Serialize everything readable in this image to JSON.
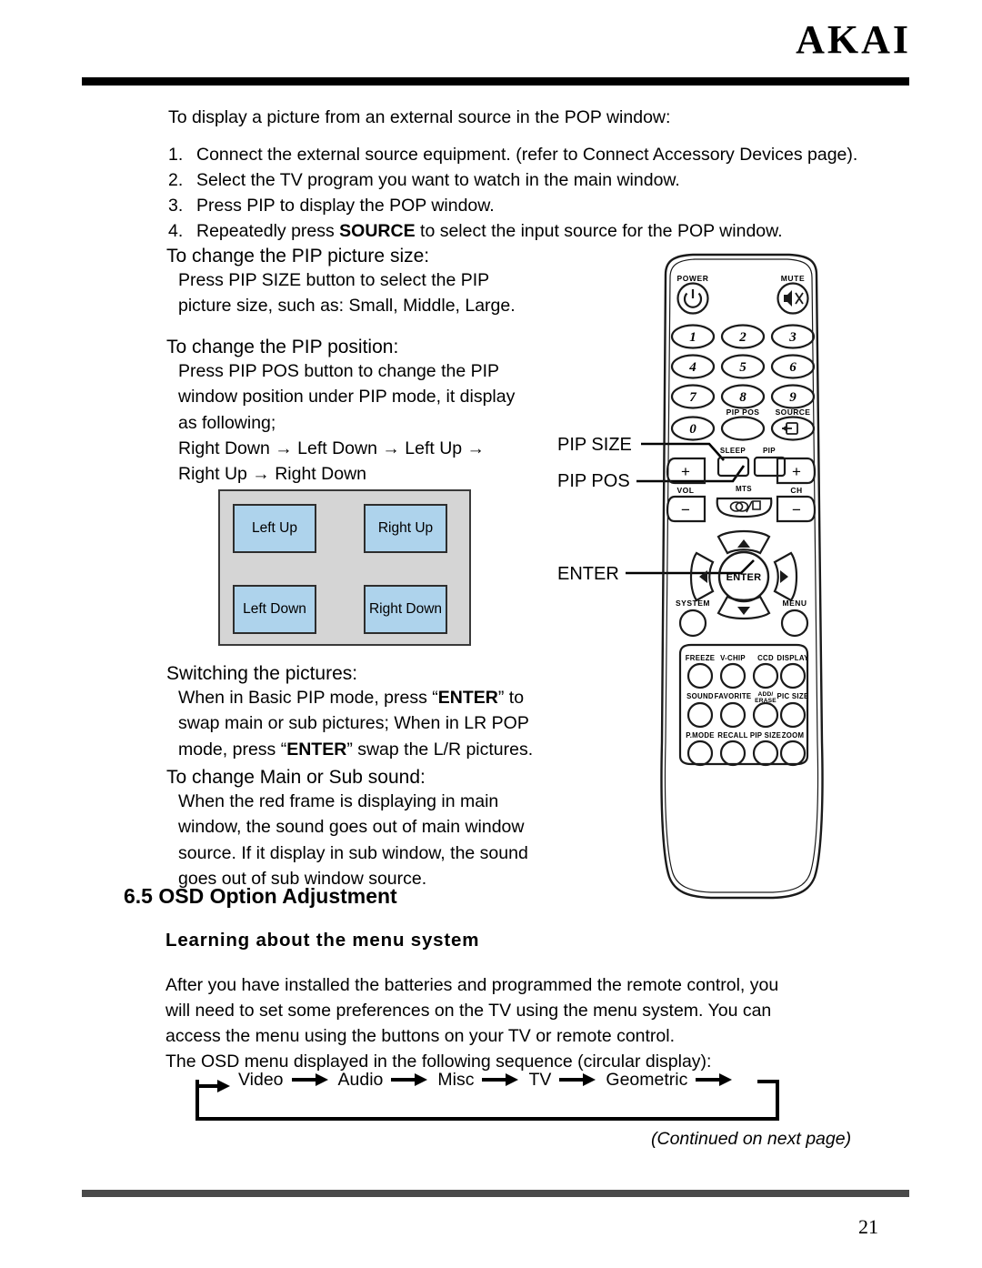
{
  "header": {
    "brand": "AKAI"
  },
  "footer": {
    "page_number": "21",
    "continued_note": "(Continued on next page)"
  },
  "intro": {
    "line": "To display a picture from an external source in the POP window:"
  },
  "steps": [
    {
      "num": "1.",
      "text_before": "Connect the external source equipment. (refer to Connect Accessory Devices page).",
      "bold": "",
      "text_after": ""
    },
    {
      "num": "2.",
      "text_before": "Select the TV program you want to watch in the main window.",
      "bold": "",
      "text_after": ""
    },
    {
      "num": "3.",
      "text_before": "Press PIP to display the POP window.",
      "bold": "",
      "text_after": ""
    },
    {
      "num": "4.",
      "text_before": "Repeatedly press ",
      "bold": "SOURCE",
      "text_after": " to select the input source for the POP window."
    }
  ],
  "sections": {
    "pip_size": {
      "heading": "To change the PIP picture size:",
      "lines": [
        "Press PIP SIZE button to select the PIP",
        "picture size, such as: Small, Middle, Large."
      ]
    },
    "pip_position": {
      "heading": "To change the PIP position:",
      "lines": [
        "Press PIP POS button to change the PIP",
        "window position under PIP mode, it display",
        "as following;",
        "Right Down → Left Down → Left Up →",
        "Right Up → Right Down"
      ]
    },
    "switching": {
      "heading": "Switching the pictures:",
      "line1_a": "When in Basic PIP mode, press “",
      "line1_bold": "ENTER",
      "line1_b": "” to",
      "line2": "swap main or sub pictures; When in LR POP",
      "line3_a": "mode, press “",
      "line3_bold": "ENTER",
      "line3_b": "” swap the L/R pictures."
    },
    "main_sub_sound": {
      "heading": "To change Main or Sub sound:",
      "lines": [
        "When the red frame is displaying in main",
        "window, the sound goes out of main window",
        "source. If it display in sub window, the sound",
        "goes out of sub window source."
      ]
    }
  },
  "pip_diagram": {
    "cells": [
      {
        "key": "left-up",
        "label": "Left Up"
      },
      {
        "key": "right-up",
        "label": "Right Up"
      },
      {
        "key": "left-down",
        "label": "Left Down"
      },
      {
        "key": "right-down",
        "label": "Right Down"
      }
    ],
    "fill_color": "#aed3ec",
    "background_color": "#d5d5d5"
  },
  "osd_section": {
    "heading": "6.5 OSD Option Adjustment",
    "subheading": "Learning about the menu system",
    "paragraph_lines": [
      "After you have installed the batteries and programmed the remote control, you",
      "will need to set some preferences on the TV using the menu system. You can",
      "access the menu using the buttons on your TV or remote control.",
      "The OSD menu displayed in the following sequence (circular display):"
    ],
    "flow_items": [
      "Video",
      "Audio",
      "Misc",
      "TV",
      "Geometric"
    ]
  },
  "callouts": [
    {
      "key": "pip-size",
      "label": "PIP SIZE"
    },
    {
      "key": "pip-pos",
      "label": "PIP POS"
    },
    {
      "key": "enter",
      "label": "ENTER"
    }
  ],
  "remote": {
    "power_label": "POWER",
    "mute_label": "MUTE",
    "digits": [
      "1",
      "2",
      "3",
      "4",
      "5",
      "6",
      "7",
      "8",
      "9",
      "0"
    ],
    "pip_pos_label": "PIP POS",
    "source_label": "SOURCE",
    "sleep_label": "SLEEP",
    "pip_label": "PIP",
    "vol_label": "VOL",
    "ch_label": "CH",
    "mts_label": "MTS",
    "plus_label": "+",
    "minus_label": "−",
    "enter_label": "ENTER",
    "system_label": "SYSTEM",
    "menu_label": "MENU",
    "keypad": [
      [
        "FREEZE",
        "V-CHIP",
        "CCD",
        "DISPLAY"
      ],
      [
        "SOUND",
        "FAVORITE",
        "ADD/\nERASE",
        "PIC SIZE"
      ],
      [
        "P.MODE",
        "RECALL",
        "PIP SIZE",
        "ZOOM"
      ]
    ]
  }
}
